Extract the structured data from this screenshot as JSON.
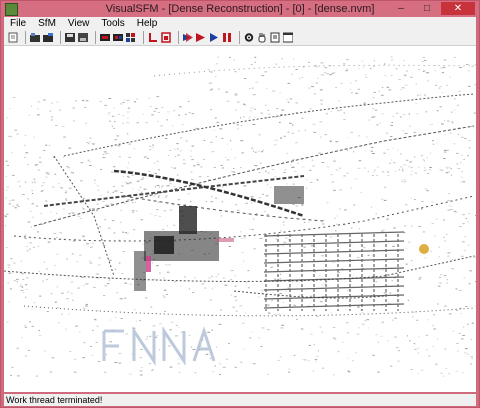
{
  "window": {
    "title": "VisualSFM - [Dense Reconstruction] - [0] - [dense.nvm]",
    "minimize": "–",
    "maximize": "□",
    "close": "✕"
  },
  "menu": {
    "items": [
      "File",
      "SfM",
      "View",
      "Tools",
      "Help"
    ]
  },
  "toolbar": {
    "icons": [
      "new-workspace-icon",
      "open-multi-images-icon",
      "open-workspace-icon",
      "save-icon",
      "export-icon",
      "compute-missing-match-icon",
      "match-pairs-icon",
      "image-grid-icon",
      "sparse-reconstruction-icon",
      "dense-reconstruction-icon",
      "run-icon",
      "step-icon",
      "record-icon",
      "pause-icon",
      "settings-gear-icon",
      "pan-hand-icon",
      "document-icon",
      "window-icon"
    ],
    "colors": {
      "accent_red": "#c0141e",
      "accent_blue": "#1e3fa0",
      "accent_green": "#2f7a2f"
    }
  },
  "status": {
    "text": "Work thread terminated!"
  }
}
